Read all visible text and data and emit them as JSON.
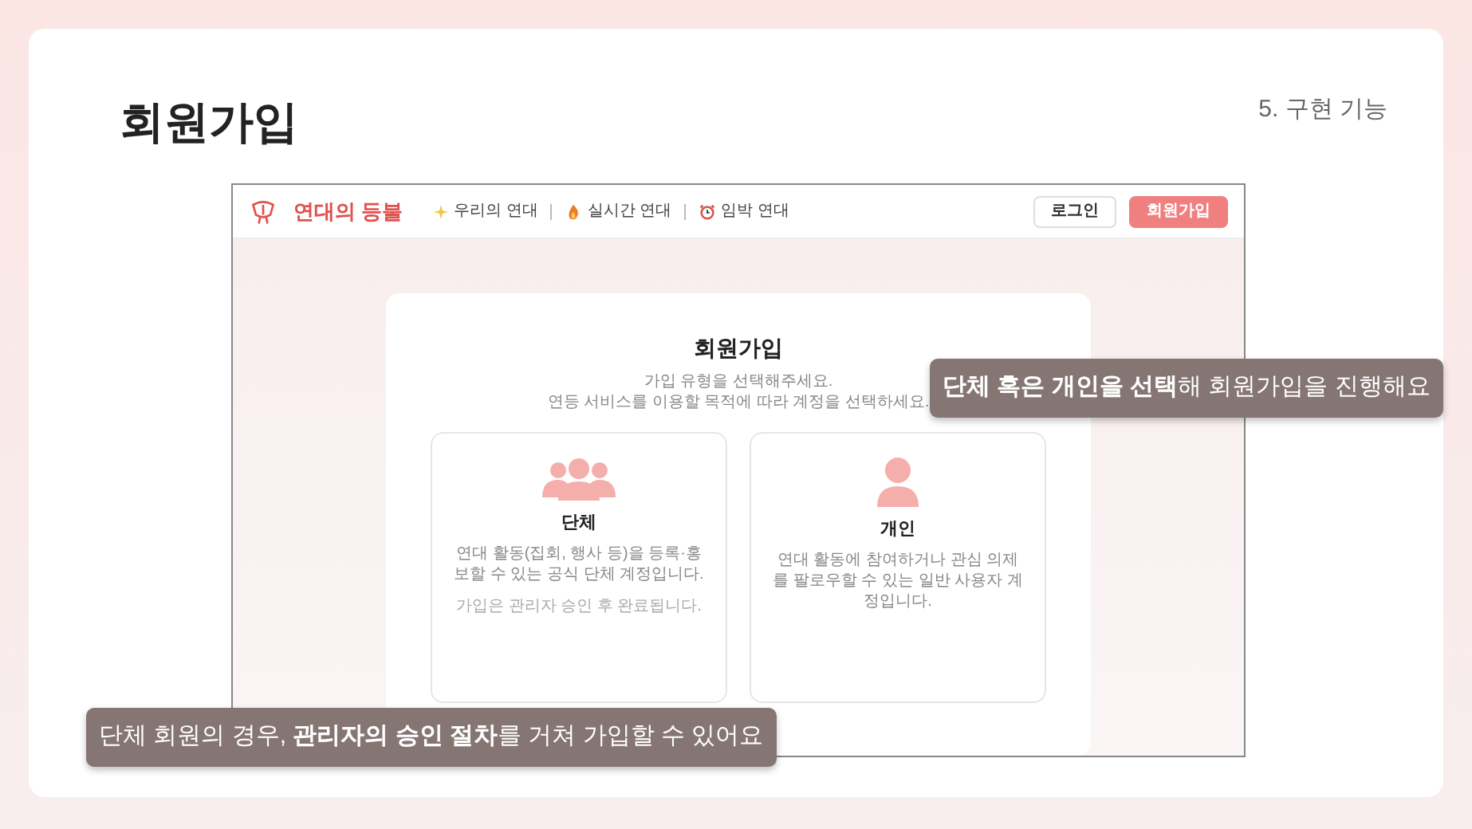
{
  "slide": {
    "title": "회원가입",
    "section": "5. 구현 기능"
  },
  "mockup": {
    "brand": "연대의 등불",
    "nav": [
      {
        "label": "우리의 연대",
        "kind": "sparkle"
      },
      {
        "label": "실시간 연대",
        "kind": "fire"
      },
      {
        "label": "임박 연대",
        "kind": "clock"
      }
    ],
    "buttons": [
      {
        "label": "로그인",
        "kind": "outline"
      },
      {
        "label": "회원가입",
        "kind": "primary"
      }
    ],
    "signup": {
      "title": "회원가입",
      "intro": [
        "가입 유형을 선택해주세요.",
        "연등 서비스를 이용할 목적에 따라 계정을 선택하세요."
      ],
      "options": [
        {
          "kind": "group",
          "title": "단체",
          "description": "연대 활동(집회, 행사 등)을 등록·홍보할 수 있는 공식 단체 계정입니다.",
          "note": "가입은 관리자 승인 후 완료됩니다."
        },
        {
          "kind": "individual",
          "title": "개인",
          "description": "연대 활동에 참여하거나 관심 의제를 팔로우할 수 있는 일반 사용자 계정입니다."
        }
      ]
    }
  },
  "callouts": [
    "**단체 혹은 개인을 선택**해 회원가입을 진행해요",
    "단체 회원의 경우, **관리자의 승인 절차**를 거쳐 가입할 수 있어요"
  ]
}
